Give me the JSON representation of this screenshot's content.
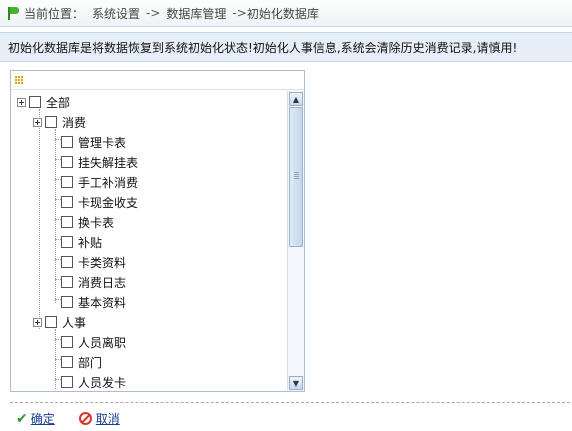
{
  "breadcrumb": {
    "prefix": "当前位置：",
    "items": [
      "系统设置",
      "数据库管理",
      "初始化数据库"
    ],
    "separator": "->"
  },
  "notice": "初始化数据库是将数据恢复到系统初始化状态!初始化人事信息,系统会清除历史消费记录,请慎用!",
  "tree": {
    "root": "全部",
    "groups": [
      {
        "label": "消费",
        "children": [
          "管理卡表",
          "挂失解挂表",
          "手工补消费",
          "卡现金收支",
          "换卡表",
          "补贴",
          "卡类资料",
          "消费日志",
          "基本资料"
        ]
      },
      {
        "label": "人事",
        "children": [
          "人员离职",
          "部门",
          "人员发卡"
        ]
      }
    ]
  },
  "actions": {
    "ok": "确定",
    "cancel": "取消"
  },
  "colors": {
    "link": "#1a3d8f",
    "notice_bg": "#e6eef7",
    "panel_border": "#a9bfd6"
  },
  "icons": {
    "location": "flag-icon",
    "ok": "check-icon",
    "cancel": "cancel-icon",
    "panel": "grid-icon"
  }
}
